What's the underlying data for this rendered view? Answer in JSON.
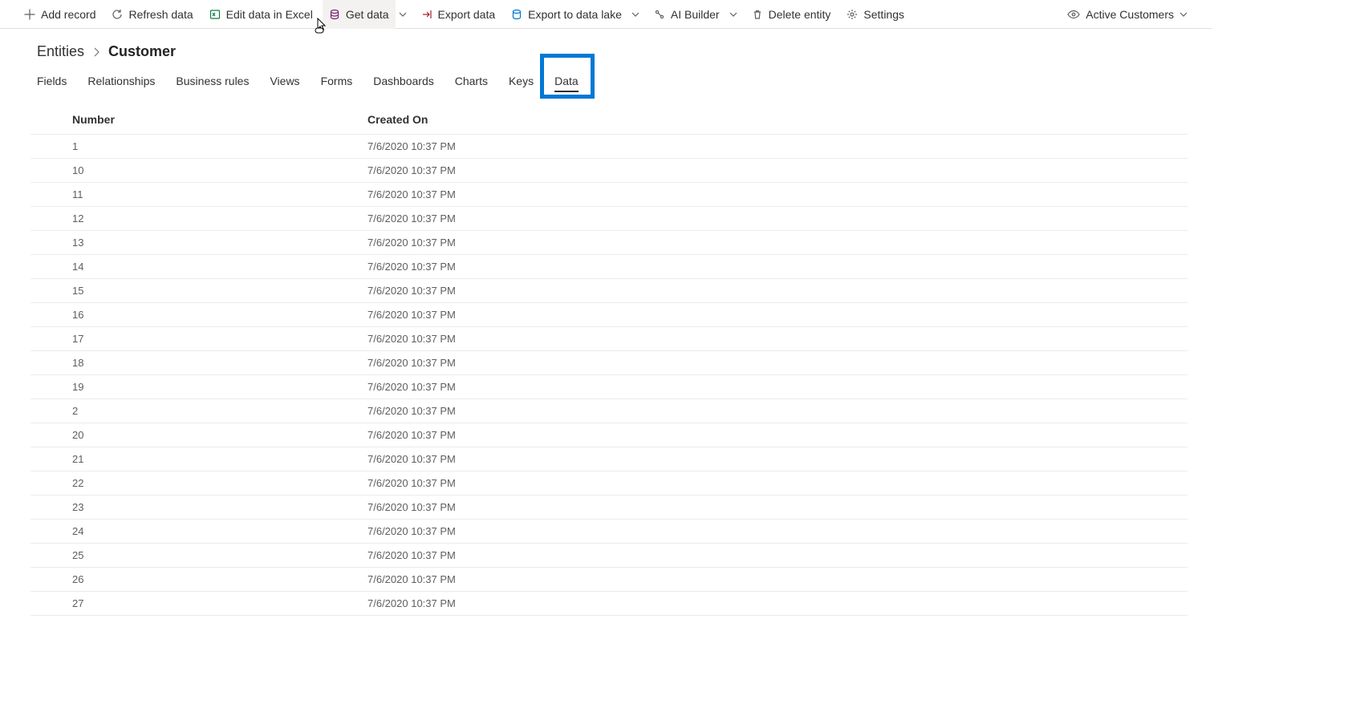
{
  "toolbar": {
    "add_record": "Add record",
    "refresh_data": "Refresh data",
    "edit_excel": "Edit data in Excel",
    "get_data": "Get data",
    "export_data": "Export data",
    "export_lake": "Export to data lake",
    "ai_builder": "AI Builder",
    "delete_entity": "Delete entity",
    "settings": "Settings",
    "active_view": "Active Customers"
  },
  "breadcrumb": {
    "root": "Entities",
    "leaf": "Customer"
  },
  "tabs": {
    "fields": "Fields",
    "relationships": "Relationships",
    "business_rules": "Business rules",
    "views": "Views",
    "forms": "Forms",
    "dashboards": "Dashboards",
    "charts": "Charts",
    "keys": "Keys",
    "data": "Data"
  },
  "grid": {
    "columns": {
      "number": "Number",
      "created_on": "Created On"
    },
    "rows": [
      {
        "number": "1",
        "created_on": "7/6/2020 10:37 PM"
      },
      {
        "number": "10",
        "created_on": "7/6/2020 10:37 PM"
      },
      {
        "number": "11",
        "created_on": "7/6/2020 10:37 PM"
      },
      {
        "number": "12",
        "created_on": "7/6/2020 10:37 PM"
      },
      {
        "number": "13",
        "created_on": "7/6/2020 10:37 PM"
      },
      {
        "number": "14",
        "created_on": "7/6/2020 10:37 PM"
      },
      {
        "number": "15",
        "created_on": "7/6/2020 10:37 PM"
      },
      {
        "number": "16",
        "created_on": "7/6/2020 10:37 PM"
      },
      {
        "number": "17",
        "created_on": "7/6/2020 10:37 PM"
      },
      {
        "number": "18",
        "created_on": "7/6/2020 10:37 PM"
      },
      {
        "number": "19",
        "created_on": "7/6/2020 10:37 PM"
      },
      {
        "number": "2",
        "created_on": "7/6/2020 10:37 PM"
      },
      {
        "number": "20",
        "created_on": "7/6/2020 10:37 PM"
      },
      {
        "number": "21",
        "created_on": "7/6/2020 10:37 PM"
      },
      {
        "number": "22",
        "created_on": "7/6/2020 10:37 PM"
      },
      {
        "number": "23",
        "created_on": "7/6/2020 10:37 PM"
      },
      {
        "number": "24",
        "created_on": "7/6/2020 10:37 PM"
      },
      {
        "number": "25",
        "created_on": "7/6/2020 10:37 PM"
      },
      {
        "number": "26",
        "created_on": "7/6/2020 10:37 PM"
      },
      {
        "number": "27",
        "created_on": "7/6/2020 10:37 PM"
      }
    ]
  }
}
